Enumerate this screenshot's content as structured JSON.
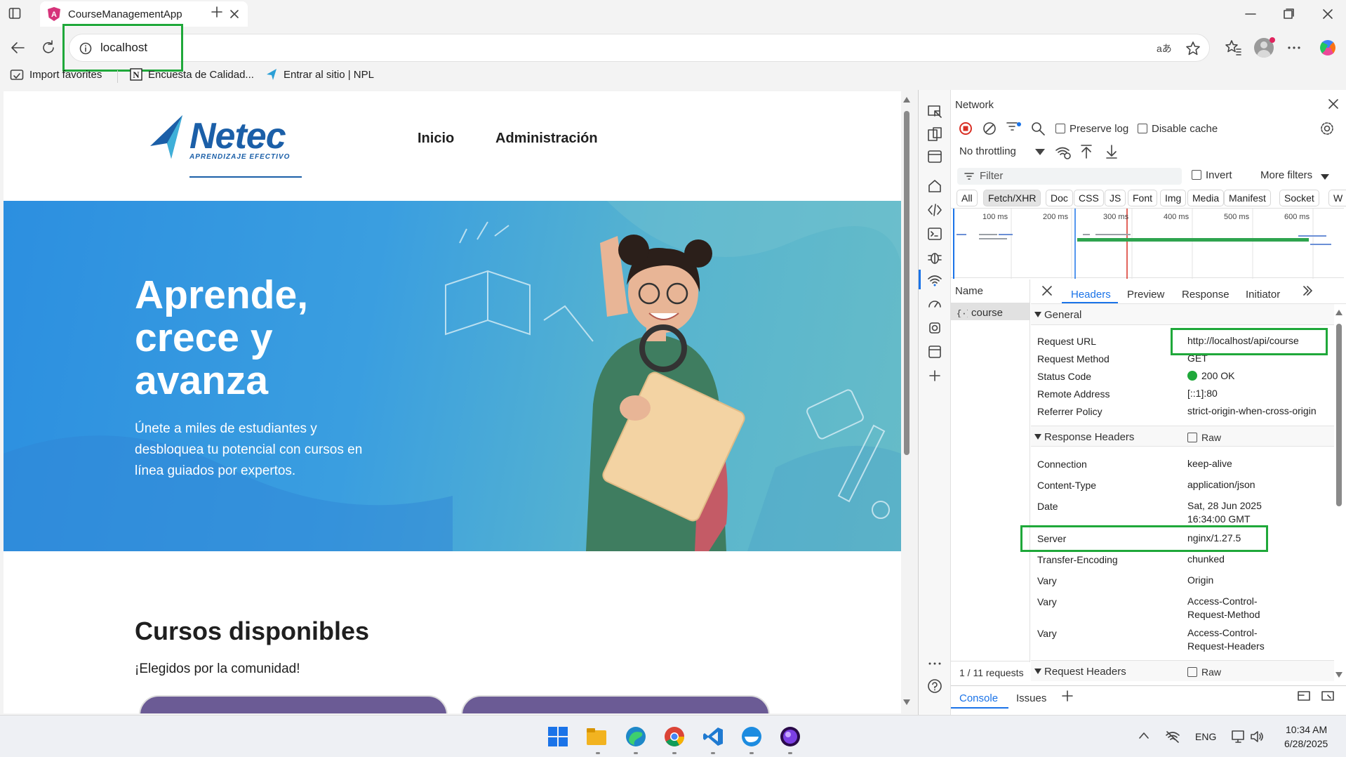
{
  "browser": {
    "tab_title": "CourseManagementApp",
    "url": "localhost",
    "bookmarks": [
      {
        "label": "Import favorites"
      },
      {
        "label": "Encuesta de Calidad..."
      },
      {
        "label": "Entrar al sitio | NPL"
      }
    ]
  },
  "site": {
    "logo_text": "Netec",
    "logo_tagline": "APRENDIZAJE EFECTIVO",
    "nav": [
      "Inicio",
      "Administración"
    ],
    "hero_title": "Aprende, crece y avanza",
    "hero_text": "Únete a miles de estudiantes y desbloquea tu potencial con cursos en línea guiados por expertos.",
    "section_title": "Cursos disponibles",
    "section_subtitle": "¡Elegidos por la comunidad!"
  },
  "devtools": {
    "panel_title": "Network",
    "preserve_log": "Preserve log",
    "disable_cache": "Disable cache",
    "throttling": "No throttling",
    "filter_placeholder": "Filter",
    "invert": "Invert",
    "more_filters": "More filters",
    "type_filters": [
      "All",
      "Fetch/XHR",
      "Doc",
      "CSS",
      "JS",
      "Font",
      "Img",
      "Media",
      "Manifest",
      "Socket",
      "W"
    ],
    "active_filter": "Fetch/XHR",
    "timeline_ticks": [
      "100 ms",
      "200 ms",
      "300 ms",
      "400 ms",
      "500 ms",
      "600 ms"
    ],
    "name_header": "Name",
    "request_name": "course",
    "detail_tabs": [
      "Headers",
      "Preview",
      "Response",
      "Initiator"
    ],
    "active_tab": "Headers",
    "general_label": "General",
    "general": [
      {
        "k": "Request URL",
        "v": "http://localhost/api/course"
      },
      {
        "k": "Request Method",
        "v": "GET"
      },
      {
        "k": "Status Code",
        "v": "200 OK"
      },
      {
        "k": "Remote Address",
        "v": "[::1]:80"
      },
      {
        "k": "Referrer Policy",
        "v": "strict-origin-when-cross-origin"
      }
    ],
    "response_headers_label": "Response Headers",
    "raw_label": "Raw",
    "response_headers": [
      {
        "k": "Connection",
        "v": "keep-alive"
      },
      {
        "k": "Content-Type",
        "v": "application/json"
      },
      {
        "k": "Date",
        "v": "Sat, 28 Jun 2025",
        "v2": "16:34:00 GMT"
      },
      {
        "k": "Server",
        "v": "nginx/1.27.5"
      },
      {
        "k": "Transfer-Encoding",
        "v": "chunked"
      },
      {
        "k": "Vary",
        "v": "Origin"
      },
      {
        "k": "Vary",
        "v": "Access-Control-",
        "v2": "Request-Method"
      },
      {
        "k": "Vary",
        "v": "Access-Control-",
        "v2": "Request-Headers"
      }
    ],
    "request_headers_label": "Request Headers",
    "requests_count": "1 / 11 requests",
    "drawer_tabs": [
      "Console",
      "Issues"
    ],
    "status_color": "#1fa83a"
  },
  "taskbar": {
    "lang": "ENG",
    "time": "10:34 AM",
    "date": "6/28/2025"
  },
  "colors": {
    "highlight": "#1fa83a",
    "accent": "#1a73e8",
    "logo_blue": "#1b5fa8"
  }
}
